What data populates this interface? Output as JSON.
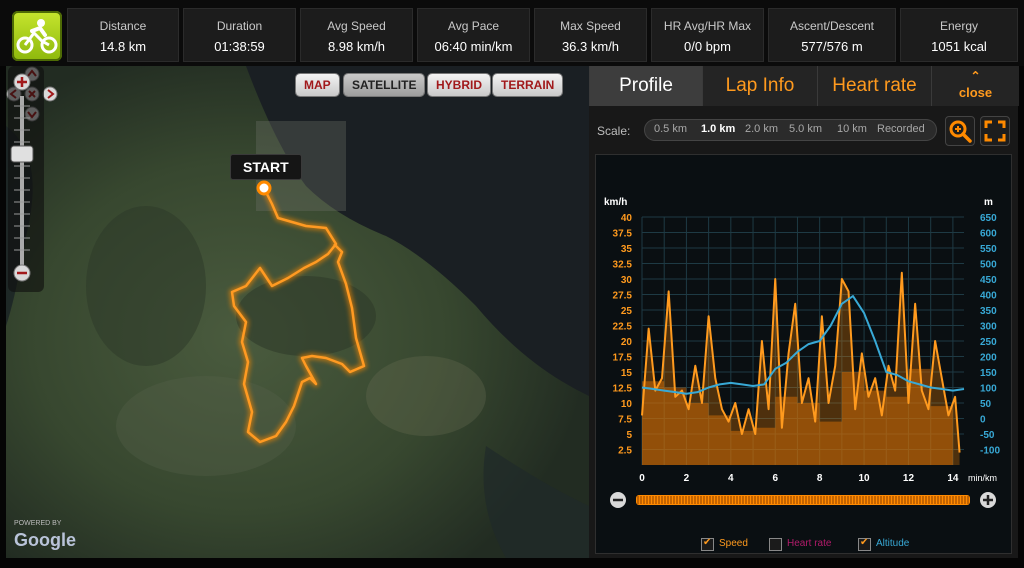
{
  "stats": [
    {
      "label": "Distance",
      "value": "14.8 km"
    },
    {
      "label": "Duration",
      "value": "01:38:59"
    },
    {
      "label": "Avg Speed",
      "value": "8.98 km/h"
    },
    {
      "label": "Avg Pace",
      "value": "06:40 min/km"
    },
    {
      "label": "Max Speed",
      "value": "36.3 km/h"
    },
    {
      "label": "HR Avg/HR Max",
      "value": "0/0 bpm"
    },
    {
      "label": "Ascent/Descent",
      "value": "577/576 m"
    },
    {
      "label": "Energy",
      "value": "1051 kcal"
    }
  ],
  "map": {
    "types": [
      "MAP",
      "SATELLITE",
      "HYBRID",
      "TERRAIN"
    ],
    "active_type": "SATELLITE",
    "start_label": "START",
    "attribution_top": "POWERED BY",
    "attribution_logo": "Google",
    "route_color": "#ff8a00"
  },
  "panel": {
    "tabs": [
      "Profile",
      "Lap Info",
      "Heart rate"
    ],
    "active_tab": "Profile",
    "close_label": "close",
    "scale_label": "Scale:",
    "scale_options": [
      "0.5 km",
      "1.0 km",
      "2.0 km",
      "5.0 km",
      "10 km",
      "Recorded"
    ],
    "scale_selected": "1.0 km",
    "legend": [
      {
        "label": "Speed",
        "checked": true,
        "color": "#ff9a1e"
      },
      {
        "label": "Heart rate",
        "checked": false,
        "color": "#b21b6a"
      },
      {
        "label": "Altitude",
        "checked": true,
        "color": "#38a9d6"
      }
    ]
  },
  "chart_data": {
    "type": "line",
    "x_unit": "min/km",
    "xlim": [
      0,
      14.5
    ],
    "x_ticks": [
      0,
      2,
      4,
      6,
      8,
      10,
      12,
      14
    ],
    "left_axis": {
      "unit": "km/h",
      "ylim": [
        0,
        40
      ],
      "ticks": [
        2.5,
        5,
        7.5,
        10,
        12.5,
        15,
        17.5,
        20,
        22.5,
        25,
        27.5,
        30,
        32.5,
        35,
        37.5,
        40
      ]
    },
    "right_axis": {
      "unit": "m",
      "ylim": [
        -150,
        650
      ],
      "ticks": [
        -100,
        -50,
        0,
        50,
        100,
        150,
        200,
        250,
        300,
        350,
        400,
        450,
        500,
        550,
        600,
        650
      ]
    },
    "grid": true,
    "series": [
      {
        "name": "Speed",
        "axis": "left",
        "x": [
          0,
          0.3,
          0.6,
          0.9,
          1.2,
          1.5,
          1.8,
          2.1,
          2.4,
          2.7,
          3.0,
          3.3,
          3.6,
          3.9,
          4.2,
          4.5,
          4.8,
          5.1,
          5.4,
          5.7,
          6.0,
          6.3,
          6.6,
          6.9,
          7.2,
          7.5,
          7.8,
          8.1,
          8.4,
          8.7,
          9.0,
          9.3,
          9.6,
          9.9,
          10.2,
          10.5,
          10.8,
          11.1,
          11.4,
          11.7,
          12.0,
          12.3,
          12.6,
          12.9,
          13.2,
          13.5,
          13.8,
          14.1,
          14.3
        ],
        "y": [
          8,
          22,
          12,
          14,
          28,
          11,
          12,
          9,
          16,
          10,
          24,
          14,
          9,
          7,
          10,
          5,
          9,
          5,
          20,
          9,
          30,
          6,
          18,
          26,
          10,
          14,
          7,
          24,
          10,
          16,
          30,
          28,
          9,
          18,
          11,
          14,
          8,
          16,
          12,
          31,
          10,
          26,
          12,
          9,
          20,
          14,
          8,
          11,
          2
        ]
      },
      {
        "name": "Speed (lap average)",
        "axis": "left",
        "x": [
          0,
          1,
          2,
          3,
          4,
          5,
          6,
          7,
          8,
          9,
          10,
          11,
          12,
          13,
          14
        ],
        "y": [
          13.5,
          12.5,
          10,
          8,
          5.5,
          6,
          11,
          10,
          7,
          15,
          12,
          11,
          15.5,
          9.5,
          0
        ]
      },
      {
        "name": "Altitude",
        "axis": "right",
        "x": [
          0,
          0.5,
          1,
          1.5,
          2,
          2.5,
          3,
          3.5,
          4,
          4.5,
          5,
          5.5,
          6,
          6.5,
          7,
          7.5,
          8,
          8.5,
          9,
          9.5,
          10,
          10.5,
          11,
          11.5,
          12,
          12.5,
          13,
          13.5,
          14,
          14.5
        ],
        "y": [
          100,
          95,
          90,
          85,
          80,
          85,
          100,
          110,
          115,
          110,
          105,
          110,
          160,
          180,
          215,
          240,
          250,
          300,
          370,
          395,
          340,
          250,
          150,
          140,
          120,
          110,
          100,
          95,
          90,
          95
        ]
      }
    ]
  }
}
